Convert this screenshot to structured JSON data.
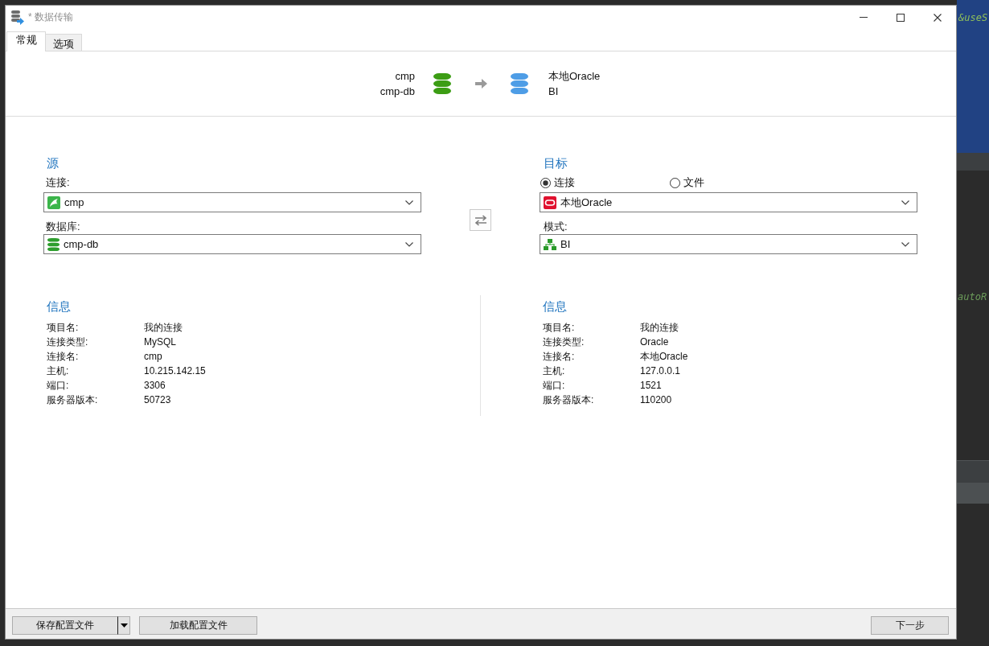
{
  "window": {
    "title": "* 数据传输"
  },
  "tabs": [
    {
      "label": "常规",
      "selected": true
    },
    {
      "label": "选项",
      "selected": false
    }
  ],
  "summary": {
    "endpoints": [
      {
        "lines": [
          "cmp",
          "cmp-db"
        ],
        "color": "#3c9d14"
      },
      {
        "lines": [
          "本地Oracle",
          "BI"
        ],
        "color": "#4e9de6"
      }
    ]
  },
  "source": {
    "heading": "源",
    "fields": [
      {
        "label": "连接:",
        "value": "cmp",
        "kind": "mysql_connection"
      },
      {
        "label": "数据库:",
        "value": "cmp-db",
        "kind": "database"
      }
    ]
  },
  "target": {
    "heading": "目标",
    "modes": [
      {
        "label": "连接",
        "selected": true
      },
      {
        "label": "文件",
        "selected": false
      }
    ],
    "fields": [
      {
        "value": "本地Oracle",
        "kind": "oracle_connection"
      },
      {
        "label": "模式:",
        "value": "BI",
        "kind": "schema"
      }
    ]
  },
  "info": [
    {
      "heading": "信息",
      "rows": [
        {
          "label": "项目名:",
          "value": "我的连接"
        },
        {
          "label": "连接类型:",
          "value": "MySQL"
        },
        {
          "label": "连接名:",
          "value": "cmp"
        },
        {
          "label": "主机:",
          "value": "10.215.142.15"
        },
        {
          "label": "端口:",
          "value": "3306"
        },
        {
          "label": "服务器版本:",
          "value": "50723"
        }
      ]
    },
    {
      "heading": "信息",
      "rows": [
        {
          "label": "项目名:",
          "value": "我的连接"
        },
        {
          "label": "连接类型:",
          "value": "Oracle"
        },
        {
          "label": "连接名:",
          "value": "本地Oracle"
        },
        {
          "label": "主机:",
          "value": "127.0.0.1"
        },
        {
          "label": "端口:",
          "value": "1521"
        },
        {
          "label": "服务器版本:",
          "value": "110200"
        }
      ]
    }
  ],
  "footer": {
    "left": [
      {
        "label": "保存配置文件",
        "kind": "split"
      },
      {
        "label": "加载配置文件",
        "kind": "plain"
      }
    ],
    "right": [
      {
        "label": "下一步",
        "kind": "plain"
      }
    ]
  },
  "editor": {
    "fragments": [
      "&useS",
      "autoR"
    ]
  }
}
